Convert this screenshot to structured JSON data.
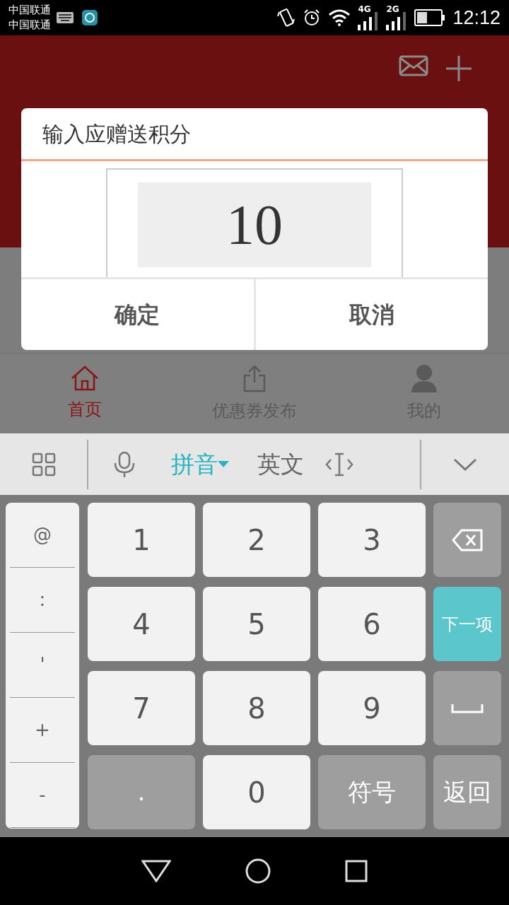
{
  "status_bar": {
    "carriers": [
      "中国联通",
      "中国联通"
    ],
    "network_labels": [
      "4G",
      "2G"
    ],
    "time": "12:12"
  },
  "dialog": {
    "title": "输入应赠送积分",
    "value": "10",
    "buttons": [
      "确定",
      "取消"
    ]
  },
  "bottom_tabs": [
    {
      "label": "首页",
      "selected": true,
      "kind": "home"
    },
    {
      "label": "优惠券发布",
      "selected": false,
      "kind": "share"
    },
    {
      "label": "我的",
      "selected": false,
      "kind": "person"
    }
  ],
  "keyboard": {
    "modes": [
      {
        "label": "拼音",
        "selected": true
      },
      {
        "label": "英文",
        "selected": false
      }
    ],
    "side_keys": [
      "@",
      ":",
      "'",
      "+",
      "-"
    ],
    "keys": [
      {
        "label": "1",
        "kind": "light"
      },
      {
        "label": "2",
        "kind": "light"
      },
      {
        "label": "3",
        "kind": "light"
      },
      {
        "kind": "backspace"
      },
      {
        "label": "4",
        "kind": "light"
      },
      {
        "label": "5",
        "kind": "light"
      },
      {
        "label": "6",
        "kind": "light"
      },
      {
        "label": "下一项",
        "kind": "action"
      },
      {
        "label": "7",
        "kind": "light"
      },
      {
        "label": "8",
        "kind": "light"
      },
      {
        "label": "9",
        "kind": "light"
      },
      {
        "kind": "space"
      },
      {
        "label": ".",
        "kind": "dark"
      },
      {
        "label": "0",
        "kind": "light"
      },
      {
        "label": "符号",
        "kind": "dark"
      },
      {
        "label": "返回",
        "kind": "dark"
      }
    ]
  }
}
